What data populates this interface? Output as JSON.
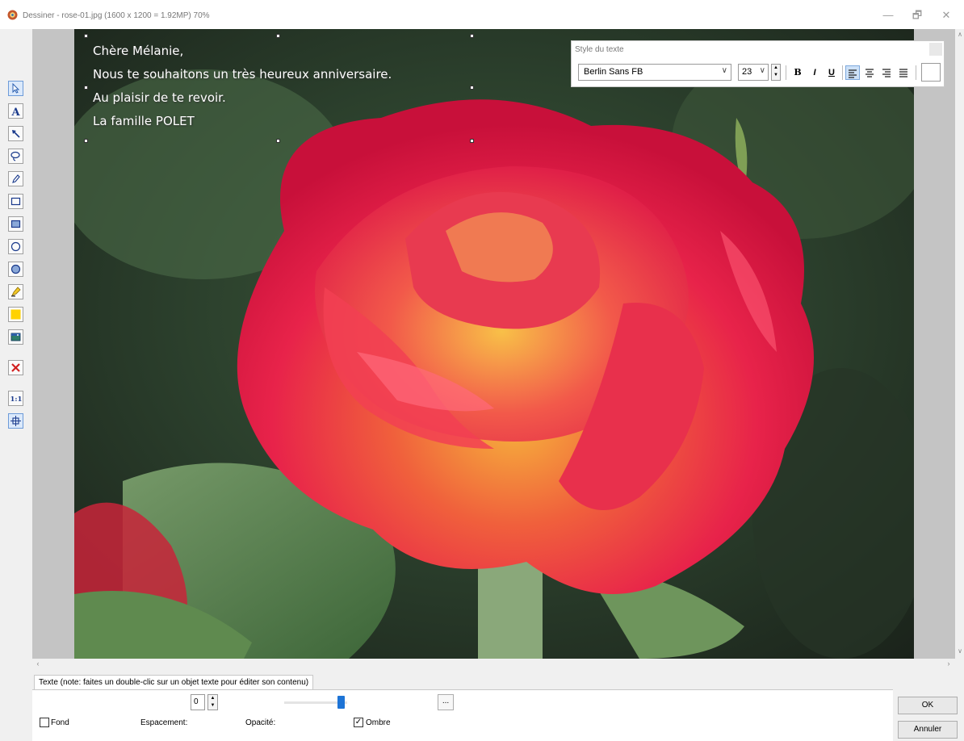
{
  "window": {
    "app_name": "Dessiner",
    "separator": "-",
    "file_info": "rose-01.jpg  (1600 x 1200 = 1.92MP)   70%",
    "minimize": "—",
    "restore": "🗗",
    "close": "✕"
  },
  "toolbar": {
    "tools": [
      {
        "name": "pointer-icon",
        "selected": true
      },
      {
        "name": "text-icon",
        "glyph": "A"
      },
      {
        "name": "arrow-icon"
      },
      {
        "name": "lasso-icon"
      },
      {
        "name": "pencil-icon"
      },
      {
        "name": "rectangle-outline-icon"
      },
      {
        "name": "rectangle-filled-icon"
      },
      {
        "name": "ellipse-outline-icon"
      },
      {
        "name": "ellipse-filled-icon"
      },
      {
        "name": "highlighter-icon"
      },
      {
        "name": "color-square-icon",
        "color": "#ffd200"
      },
      {
        "name": "image-insert-icon"
      },
      {
        "name": "delete-icon",
        "glyph": "✕",
        "color": "#d12020"
      },
      {
        "name": "zoom-actual-icon",
        "glyph": "1:1"
      },
      {
        "name": "fit-view-icon",
        "selected": true
      }
    ]
  },
  "image_text": {
    "lines": [
      "Chère Mélanie,",
      "Nous te souhaitons un très heureux anniversaire.",
      "Au plaisir de te revoir.",
      "La famille POLET"
    ]
  },
  "text_style": {
    "title": "Style du texte",
    "font": "Berlin Sans FB",
    "size": "23",
    "bold": "B",
    "italic": "I",
    "underline": "U",
    "align_left_selected": true
  },
  "bottom_panel": {
    "tab_label": "Texte (note: faites un double-clic sur un objet texte pour éditer son contenu)",
    "background_label": "Fond",
    "spacing_label": "Espacement:",
    "spacing_value": "0",
    "opacity_label": "Opacité:",
    "opacity_value": 0.9,
    "shadow_label": "Ombre",
    "shadow_checked": true,
    "more_label": "...",
    "ok_label": "OK",
    "cancel_label": "Annuler"
  },
  "colors": {
    "accent": "#1d74d6",
    "rose": "#e8234a",
    "canvas_bg": "#c4c4c4"
  }
}
